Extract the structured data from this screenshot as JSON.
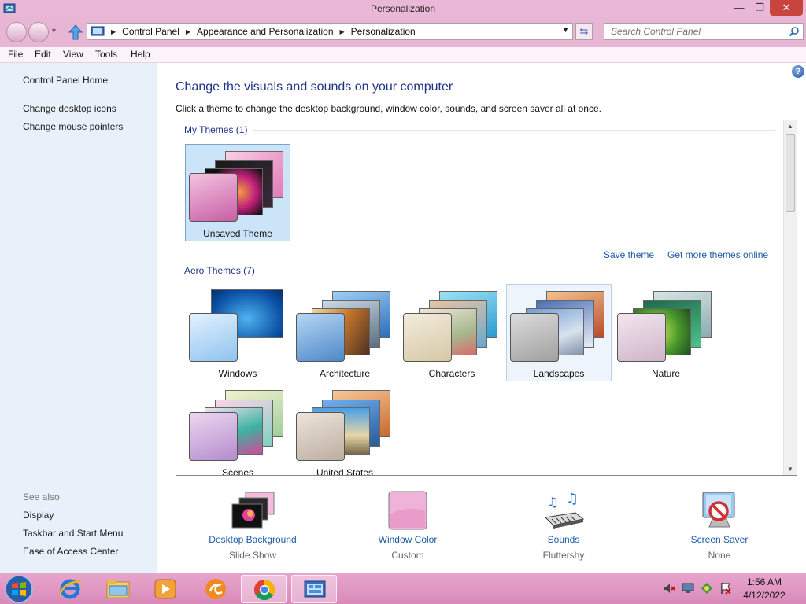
{
  "window": {
    "title": "Personalization"
  },
  "address": {
    "crumbs": [
      "Control Panel",
      "Appearance and Personalization",
      "Personalization"
    ]
  },
  "search": {
    "placeholder": "Search Control Panel"
  },
  "menu": [
    "File",
    "Edit",
    "View",
    "Tools",
    "Help"
  ],
  "sidebar": {
    "home": "Control Panel Home",
    "links": [
      "Change desktop icons",
      "Change mouse pointers"
    ],
    "see_also_title": "See also",
    "see_also": [
      "Display",
      "Taskbar and Start Menu",
      "Ease of Access Center"
    ]
  },
  "main": {
    "title": "Change the visuals and sounds on your computer",
    "subtitle": "Click a theme to change the desktop background, window color, sounds, and screen saver all at once."
  },
  "groups": {
    "my_themes": {
      "label": "My Themes (1)",
      "items": [
        {
          "name": "Unsaved Theme",
          "selected": true
        }
      ]
    },
    "actions": {
      "save": "Save theme",
      "more": "Get more themes online"
    },
    "aero_themes": {
      "label": "Aero Themes (7)",
      "items": [
        {
          "name": "Windows"
        },
        {
          "name": "Architecture"
        },
        {
          "name": "Characters"
        },
        {
          "name": "Landscapes",
          "hover": true
        },
        {
          "name": "Nature"
        },
        {
          "name": "Scenes"
        },
        {
          "name": "United States"
        }
      ]
    }
  },
  "bottom": [
    {
      "label": "Desktop Background",
      "value": "Slide Show",
      "icon": "desktop-background-icon"
    },
    {
      "label": "Window Color",
      "value": "Custom",
      "icon": "window-color-icon"
    },
    {
      "label": "Sounds",
      "value": "Fluttershy",
      "icon": "sounds-icon"
    },
    {
      "label": "Screen Saver",
      "value": "None",
      "icon": "screen-saver-icon"
    }
  ],
  "taskbar": {
    "apps": [
      "internet-explorer-icon",
      "file-explorer-icon",
      "media-player-icon",
      "uc-browser-icon",
      "chrome-icon",
      "control-panel-icon"
    ],
    "tray": [
      "volume-muted-icon",
      "network-icon",
      "action-center-icon",
      "flag-icon"
    ],
    "time": "1:56 AM",
    "date": "4/12/2022"
  },
  "colors": {
    "accent": "#1e3287",
    "link": "#1b5aa6",
    "window_frame": "#e8b6d5",
    "sidebar": "#e8f0fa",
    "selection": "#cce4f7",
    "close_button": "#c7453c"
  }
}
